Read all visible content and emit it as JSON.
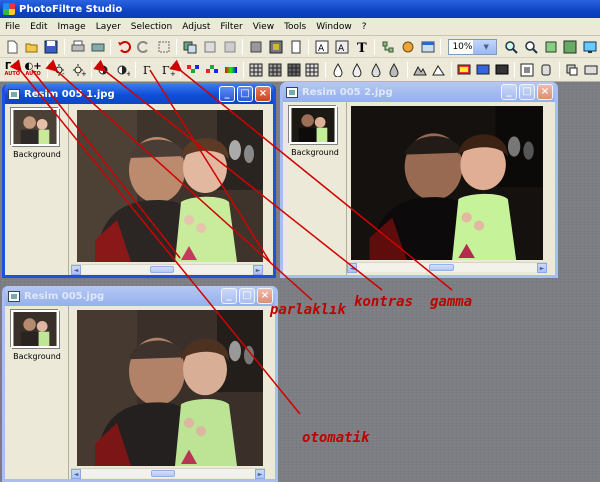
{
  "app": {
    "title": "PhotoFiltre Studio"
  },
  "menu": [
    "File",
    "Edit",
    "Image",
    "Layer",
    "Selection",
    "Adjust",
    "Filter",
    "View",
    "Tools",
    "Window",
    "?"
  ],
  "toolbar": {
    "zoom_value": "10%"
  },
  "toolbar2": {
    "auto_label_1": "AUTO",
    "auto_label_2": "AUTO"
  },
  "windows": [
    {
      "title": "Resim 005 1.jpg",
      "layer_label": "Background",
      "state": "active"
    },
    {
      "title": "Resim 005 2.jpg",
      "layer_label": "Background",
      "state": "inactive"
    },
    {
      "title": "Resim 005.jpg",
      "layer_label": "Background",
      "state": "inactive"
    }
  ],
  "window_buttons": {
    "minimize": "_",
    "maximize": "□",
    "close": "×"
  },
  "scroll": {
    "left": "◄",
    "right": "►"
  },
  "annotations": {
    "parlaklik": "parlaklık",
    "kontras": "kontras",
    "gamma": "gamma",
    "otomatik": "otomatik"
  },
  "colors": {
    "title_blue": "#0d44c4",
    "annotation_red": "#c00000",
    "desk_gray": "#7c7e83",
    "panel_beige": "#ece9d8"
  },
  "icons": [
    "new-icon",
    "open-icon",
    "save-icon",
    "print-icon",
    "scan-icon",
    "undo-icon",
    "redo-icon",
    "crop-icon",
    "text-icon",
    "zoom-in-icon",
    "zoom-out-icon"
  ]
}
